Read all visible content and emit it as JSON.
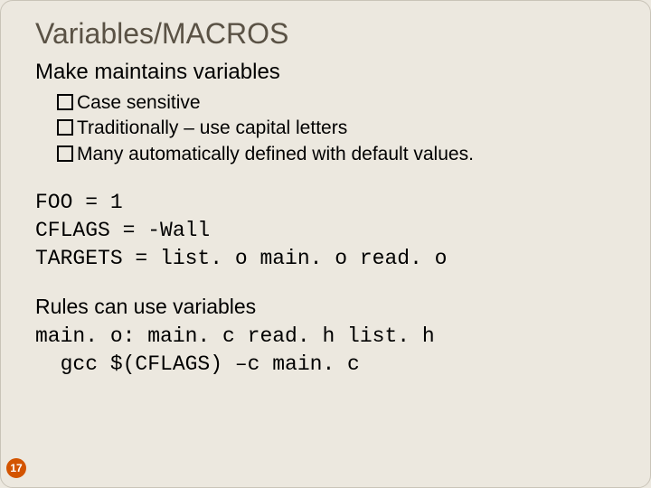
{
  "slide": {
    "title": "Variables/MACROS",
    "subtitle": "Make maintains variables",
    "bullets": [
      "Case sensitive",
      "Traditionally – use capital letters",
      "Many automatically defined with default values."
    ],
    "code1": {
      "line1": "FOO = 1",
      "line2": "CFLAGS = -Wall",
      "line3": "TARGETS = list. o main. o read. o"
    },
    "rules_text": "Rules can use variables",
    "code2": {
      "line1": "main. o: main. c read. h list. h",
      "line2": "  gcc $(CFLAGS) –c main. c"
    },
    "page_number": "17"
  }
}
